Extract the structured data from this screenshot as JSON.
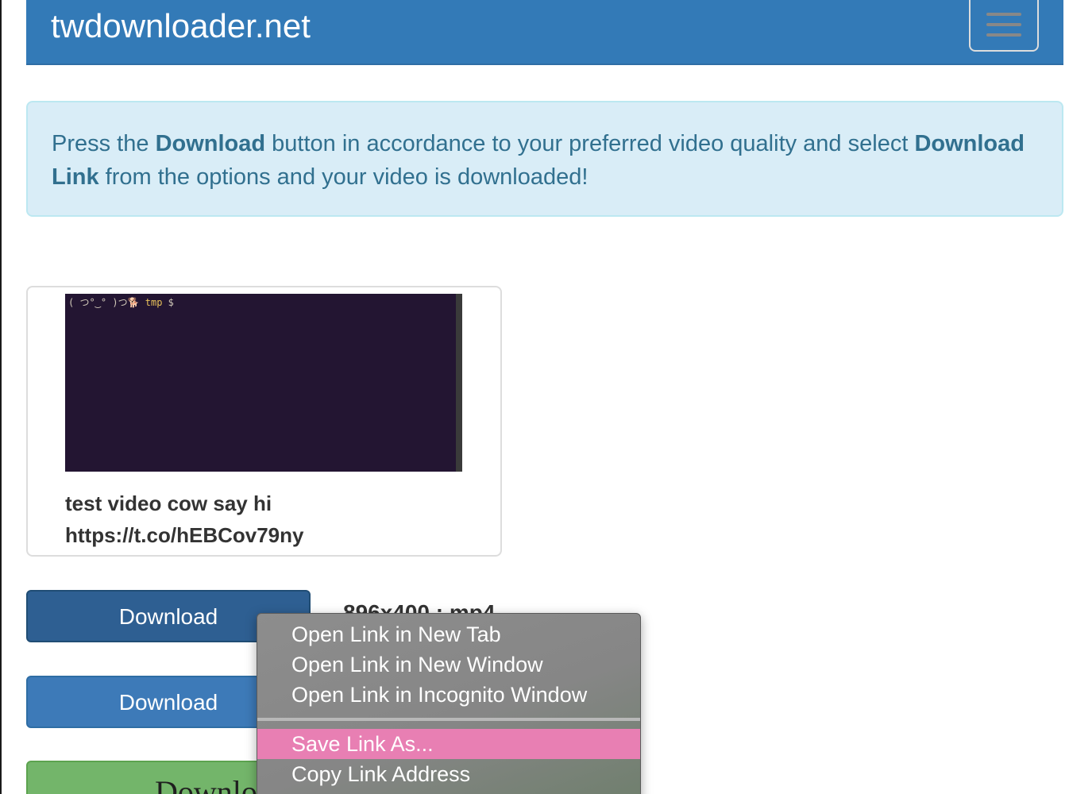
{
  "navbar": {
    "brand": "twdownloader.net",
    "toggle_icon": "hamburger-menu-icon"
  },
  "alert": {
    "text_1": "Press the ",
    "bold_1": "Download",
    "text_2": " button in accordance to your preferred video quality and select ",
    "bold_2": "Download Link",
    "text_3": " from the options and your video is downloaded!"
  },
  "video": {
    "prompt_face": "( つ°‿° )つ🐕",
    "prompt_dir": "tmp",
    "prompt_symbol": "$",
    "caption_line1": "test video cow say hi",
    "caption_line2": "https://t.co/hEBCov79ny"
  },
  "downloads": [
    {
      "label": "Download",
      "format": "896x400 : mp4"
    },
    {
      "label": "Download"
    },
    {
      "label": "Downlo"
    }
  ],
  "context_menu": {
    "items": [
      "Open Link in New Tab",
      "Open Link in New Window",
      "Open Link in Incognito Window",
      "Save Link As...",
      "Copy Link Address"
    ],
    "highlighted": "Save Link As..."
  },
  "colors": {
    "navbar": "#337ab7",
    "alert_bg": "#d9edf7",
    "alert_text": "#31708f",
    "button_primary": "#3d7ab8",
    "button_success": "#73b56a",
    "menu_highlight": "#e87fb3"
  }
}
